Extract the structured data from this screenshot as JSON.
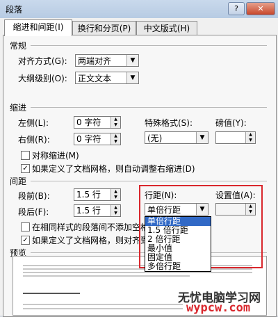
{
  "window": {
    "title": "段落",
    "help_label": "?",
    "close_label": "✕"
  },
  "tabs": [
    {
      "label": "缩进和间距(I)"
    },
    {
      "label": "换行和分页(P)"
    },
    {
      "label": "中文版式(H)"
    }
  ],
  "general": {
    "heading": "常规",
    "alignment_label": "对齐方式(G):",
    "alignment_value": "两端对齐",
    "outline_label": "大纲级别(O):",
    "outline_value": "正文文本"
  },
  "indent": {
    "heading": "缩进",
    "left_label": "左侧(L):",
    "left_value": "0 字符",
    "right_label": "右侧(R):",
    "right_value": "0 字符",
    "special_label": "特殊格式(S):",
    "special_value": "(无)",
    "measure_label": "磅值(Y):",
    "mirror_label": "对称缩进(M)",
    "mirror_checked": false,
    "auto_right_label": "如果定义了文档网格，则自动调整右缩进(D)",
    "auto_right_checked": true
  },
  "spacing": {
    "heading": "间距",
    "before_label": "段前(B):",
    "before_value": "1.5 行",
    "after_label": "段后(F):",
    "after_value": "1.5 行",
    "line_spacing_label": "行距(N):",
    "line_spacing_value": "单倍行距",
    "setting_label": "设置值(A):",
    "no_space_label": "在相同样式的段落间不添加空格",
    "no_space_checked": false,
    "snap_grid_label": "如果定义了文档网格，则对齐到",
    "snap_grid_checked": true,
    "line_spacing_options": [
      "单倍行距",
      "1.5 倍行距",
      "2 倍行距",
      "最小值",
      "固定值",
      "多倍行距"
    ],
    "selected_option_index": 0
  },
  "preview": {
    "heading": "预览"
  },
  "watermark": {
    "text": "无忧电脑学习网",
    "url": "wypcw.com"
  },
  "colors": {
    "highlight_border": "#d9272d",
    "selection": "#3169c6"
  }
}
